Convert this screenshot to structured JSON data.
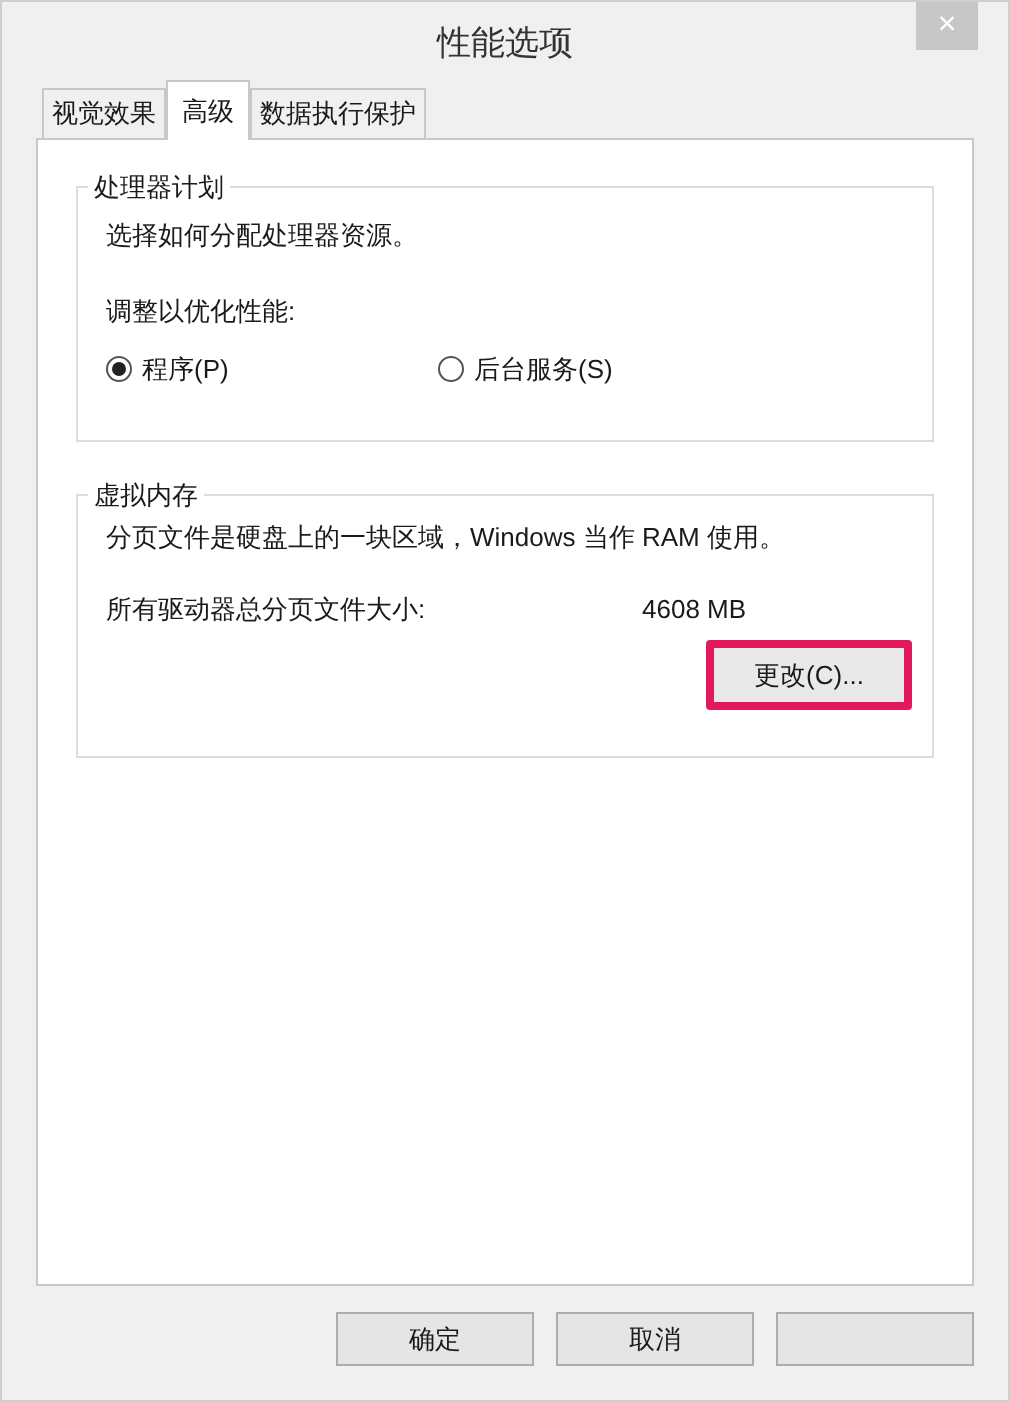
{
  "window": {
    "title": "性能选项",
    "close": "×"
  },
  "tabs": [
    {
      "label": "视觉效果",
      "selected": false
    },
    {
      "label": "高级",
      "selected": true
    },
    {
      "label": "数据执行保护",
      "selected": false
    }
  ],
  "processor": {
    "title": "处理器计划",
    "description": "选择如何分配处理器资源。",
    "prompt": "调整以优化性能:",
    "options": [
      {
        "label": "程序(P)",
        "selected": true
      },
      {
        "label": "后台服务(S)",
        "selected": false
      }
    ]
  },
  "virtual_memory": {
    "title": "虚拟内存",
    "description": "分页文件是硬盘上的一块区域，Windows 当作 RAM 使用。",
    "size_label": "所有驱动器总分页文件大小:",
    "size_value": "4608 MB",
    "change_button": "更改(C)..."
  },
  "buttons": [
    {
      "kind": "text",
      "label": "确定"
    },
    {
      "kind": "text",
      "label": "取消"
    },
    {
      "kind": "blank"
    }
  ]
}
